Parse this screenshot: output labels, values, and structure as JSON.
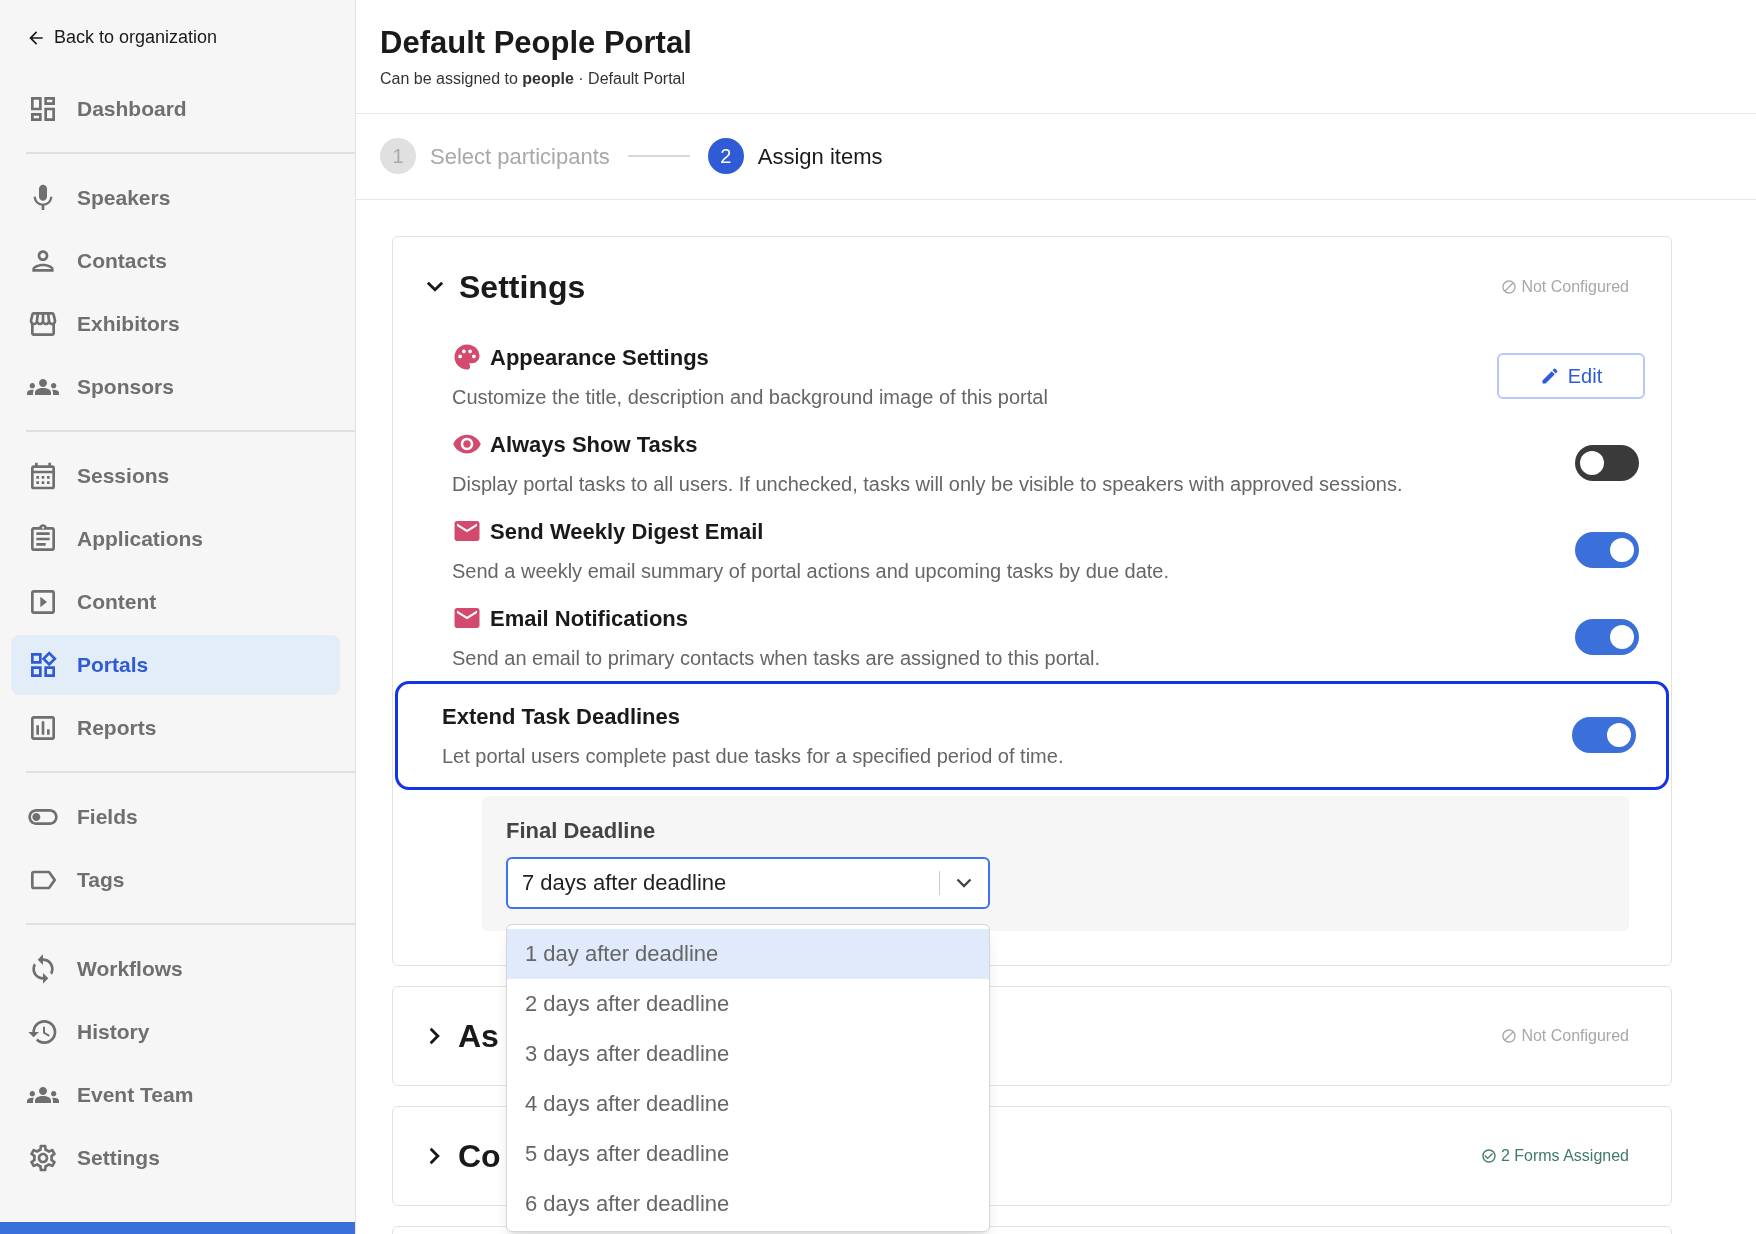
{
  "sidebar": {
    "back_link": "Back to organization",
    "groups": [
      [
        {
          "label": "Dashboard",
          "selected": false
        }
      ],
      [
        {
          "label": "Speakers",
          "selected": false
        },
        {
          "label": "Contacts",
          "selected": false
        },
        {
          "label": "Exhibitors",
          "selected": false
        },
        {
          "label": "Sponsors",
          "selected": false
        }
      ],
      [
        {
          "label": "Sessions",
          "selected": false
        },
        {
          "label": "Applications",
          "selected": false
        },
        {
          "label": "Content",
          "selected": false
        },
        {
          "label": "Portals",
          "selected": true
        },
        {
          "label": "Reports",
          "selected": false
        }
      ],
      [
        {
          "label": "Fields",
          "selected": false
        },
        {
          "label": "Tags",
          "selected": false
        }
      ],
      [
        {
          "label": "Workflows",
          "selected": false
        },
        {
          "label": "History",
          "selected": false
        },
        {
          "label": "Event Team",
          "selected": false
        },
        {
          "label": "Settings",
          "selected": false
        }
      ]
    ]
  },
  "header": {
    "title": "Default People Portal",
    "subtitle": "Can be assigned to **people** · Default Portal"
  },
  "steps": [
    {
      "number": "1",
      "label": "Select participants",
      "selected": false
    },
    {
      "number": "2",
      "label": "Assign items",
      "selected": true
    }
  ],
  "settings_section": {
    "title": "Settings",
    "expanded": true,
    "status": "Not Configured",
    "kind": "not_configured",
    "rows": [
      {
        "kind": "button",
        "title": "Appearance Settings",
        "description": "Customize the title, description and background image of this portal",
        "button": "Edit",
        "highlighted": false
      },
      {
        "kind": "toggle",
        "title": "Always Show Tasks",
        "description": "Display portal tasks to all users. If unchecked, tasks will only be visible to speakers with approved sessions.",
        "on": false,
        "highlighted": false
      },
      {
        "kind": "toggle",
        "title": "Send Weekly Digest Email",
        "description": "Send a weekly email summary of portal actions and upcoming tasks by due date.",
        "on": true,
        "highlighted": false
      },
      {
        "kind": "toggle",
        "title": "Email Notifications",
        "description": "Send an email to primary contacts when tasks are assigned to this portal.",
        "on": true,
        "highlighted": false
      },
      {
        "kind": "toggle",
        "title": "Extend Task Deadlines",
        "description": "Let portal users complete past due tasks for a specified period of time.",
        "on": true,
        "highlighted": true
      }
    ],
    "final_deadline": {
      "label": "Final Deadline",
      "value": "7 days after deadline",
      "expanded": true,
      "options": [
        {
          "label": "1 day after deadline",
          "selected": true
        },
        {
          "label": "2 days after deadline",
          "selected": false
        },
        {
          "label": "3 days after deadline",
          "selected": false
        },
        {
          "label": "4 days after deadline",
          "selected": false
        },
        {
          "label": "5 days after deadline",
          "selected": false
        },
        {
          "label": "6 days after deadline",
          "selected": false
        }
      ]
    }
  },
  "collapsed_sections": [
    {
      "title": "As",
      "expanded": false,
      "status": "Not Configured",
      "kind": "not_configured"
    },
    {
      "title": "Co",
      "expanded": false,
      "status": "2 Forms Assigned",
      "kind": "assigned"
    }
  ]
}
